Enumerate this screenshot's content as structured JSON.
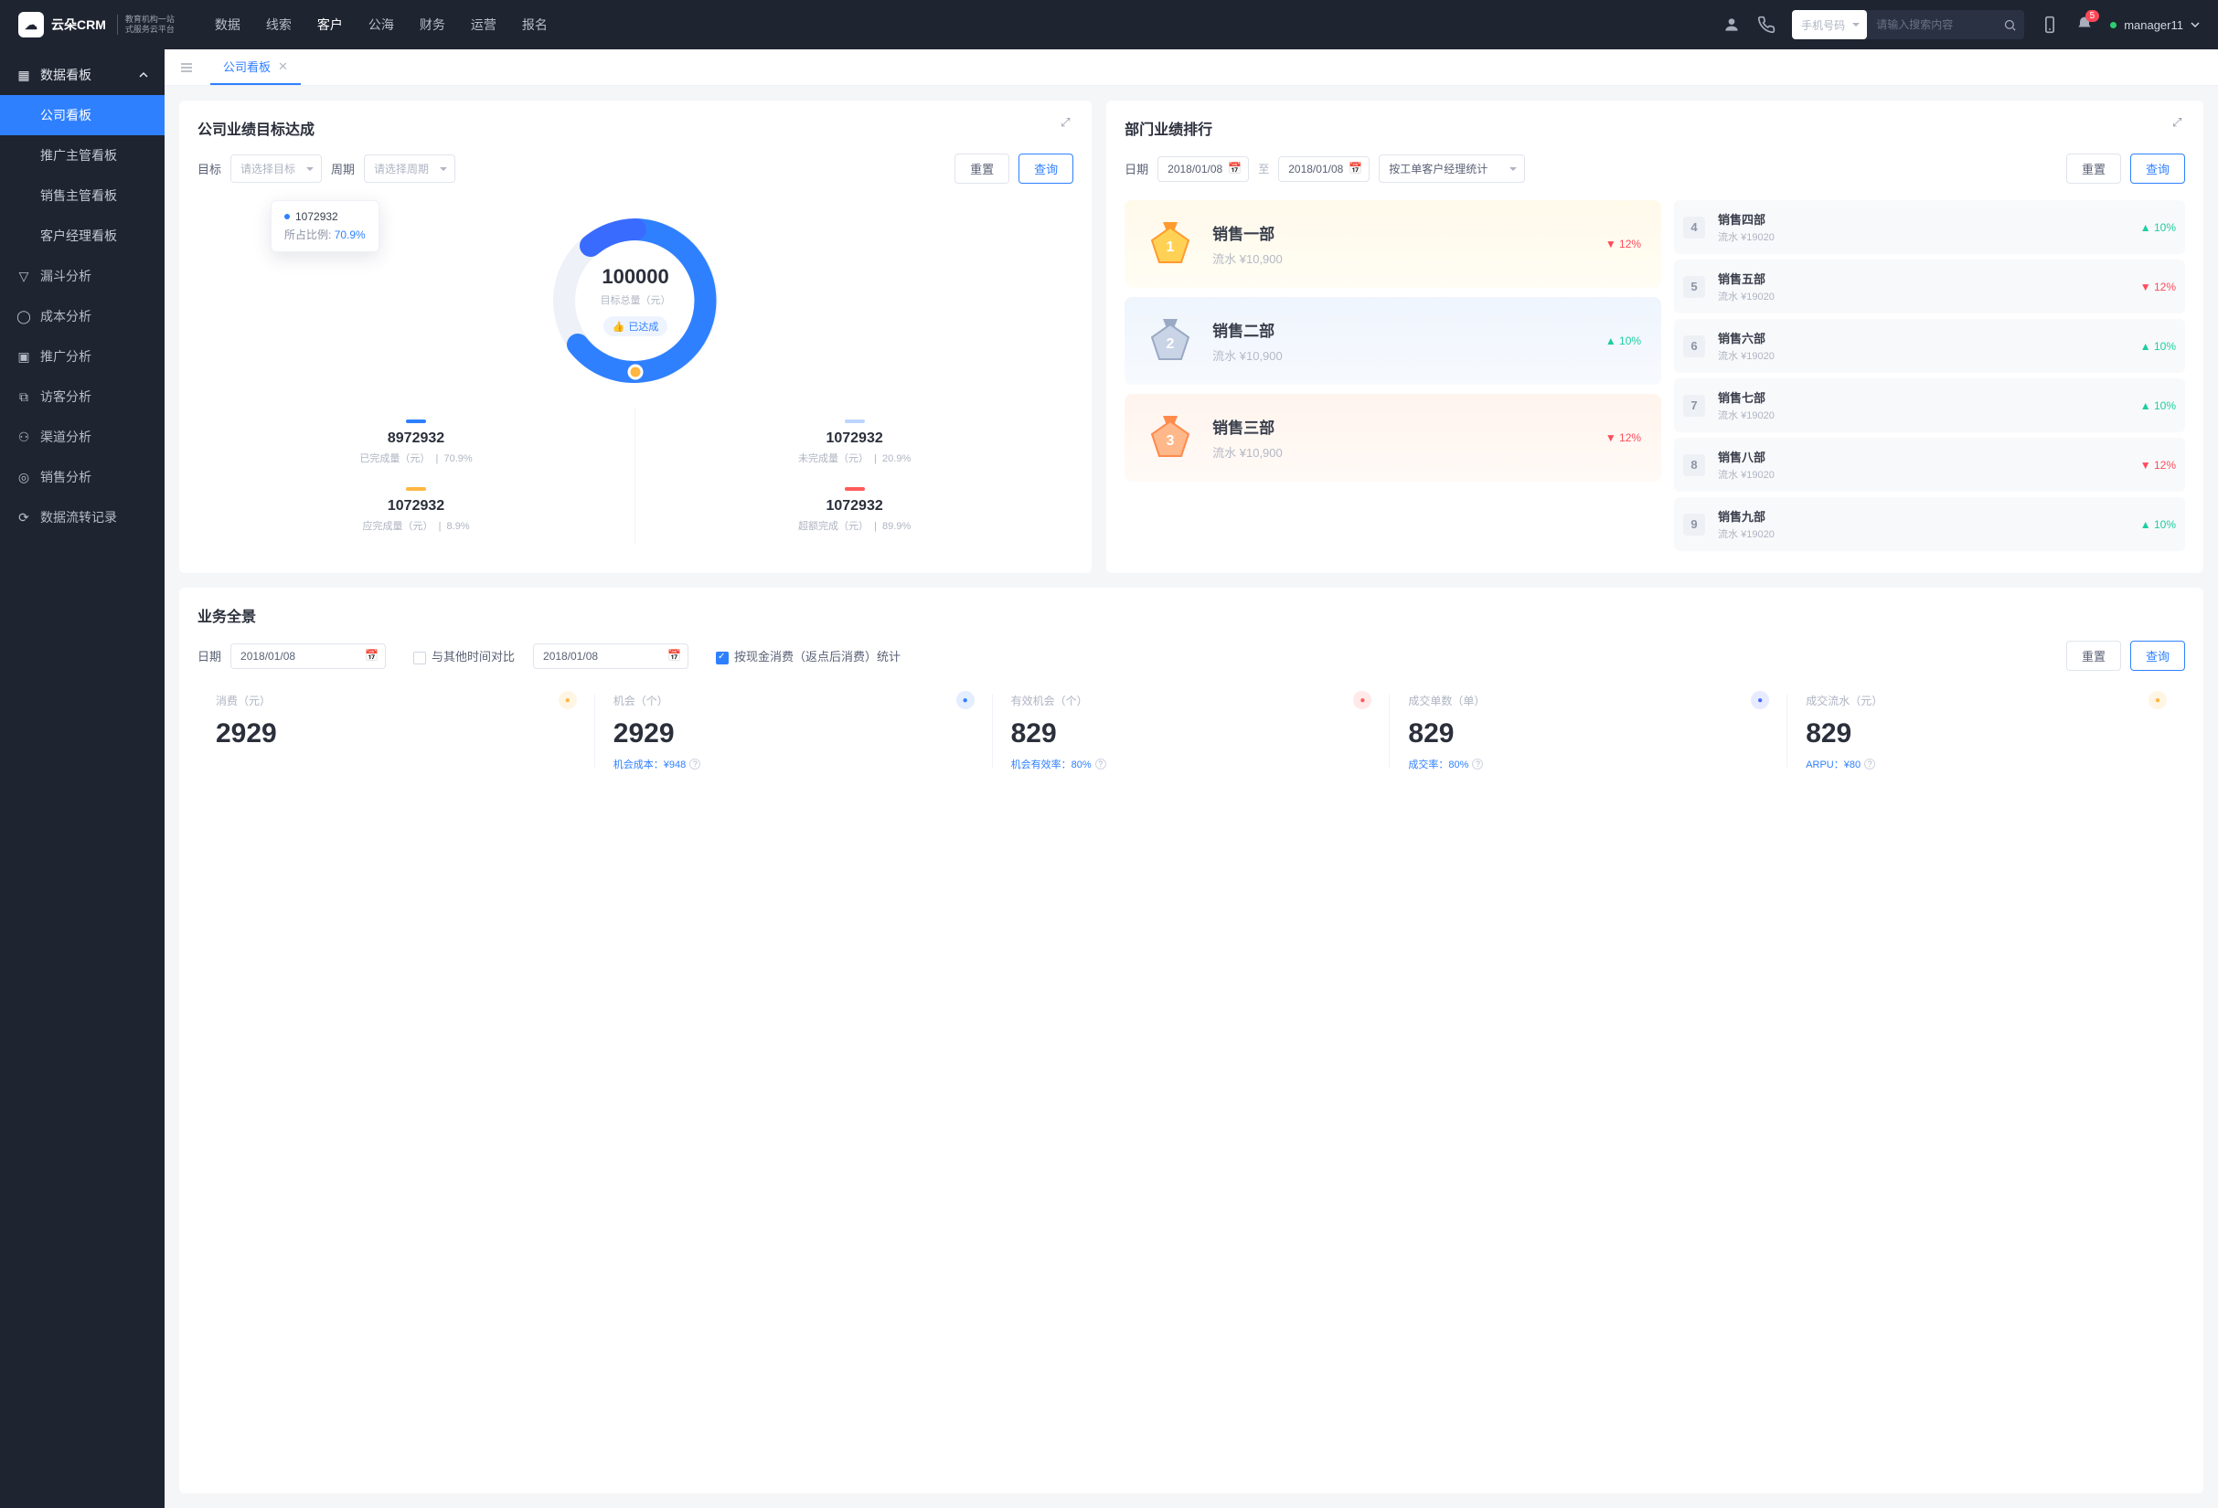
{
  "brand": {
    "name": "云朵CRM",
    "tagline1": "教育机构一站",
    "tagline2": "式服务云平台"
  },
  "topnav": [
    "数据",
    "线索",
    "客户",
    "公海",
    "财务",
    "运营",
    "报名"
  ],
  "topnav_active": 2,
  "search": {
    "type": "手机号码",
    "placeholder": "请输入搜索内容"
  },
  "notif_count": "5",
  "user": "manager11",
  "sidebar": {
    "header": "数据看板",
    "subs": [
      "公司看板",
      "推广主管看板",
      "销售主管看板",
      "客户经理看板"
    ],
    "items": [
      "漏斗分析",
      "成本分析",
      "推广分析",
      "访客分析",
      "渠道分析",
      "销售分析",
      "数据流转记录"
    ]
  },
  "tab": {
    "label": "公司看板"
  },
  "goal": {
    "title": "公司业绩目标达成",
    "labels": {
      "target": "目标",
      "target_ph": "请选择目标",
      "period": "周期",
      "period_ph": "请选择周期",
      "reset": "重置",
      "query": "查询"
    },
    "tooltip": {
      "value": "1072932",
      "ratio_label": "所占比例:",
      "ratio": "70.9%"
    },
    "center": {
      "value": "100000",
      "label": "目标总量（元）",
      "badge": "已达成"
    },
    "stats": [
      {
        "bar": "#2f80ff",
        "value": "8972932",
        "label": "已完成量（元）",
        "pct": "70.9%"
      },
      {
        "bar": "#bcd5ff",
        "value": "1072932",
        "label": "未完成量（元）",
        "pct": "20.9%"
      },
      {
        "bar": "#ffb73f",
        "value": "1072932",
        "label": "应完成量（元）",
        "pct": "8.9%"
      },
      {
        "bar": "#ff5a5a",
        "value": "1072932",
        "label": "超额完成（元）",
        "pct": "89.9%"
      }
    ]
  },
  "rank": {
    "title": "部门业绩排行",
    "labels": {
      "date": "日期",
      "from": "2018/01/08",
      "sep": "至",
      "to": "2018/01/08",
      "stat_by": "按工单客户经理统计",
      "reset": "重置",
      "query": "查询"
    },
    "podium": [
      {
        "n": "1",
        "name": "销售一部",
        "sub": "流水 ¥10,900",
        "delta": "12%",
        "dir": "down"
      },
      {
        "n": "2",
        "name": "销售二部",
        "sub": "流水 ¥10,900",
        "delta": "10%",
        "dir": "up"
      },
      {
        "n": "3",
        "name": "销售三部",
        "sub": "流水 ¥10,900",
        "delta": "12%",
        "dir": "down"
      }
    ],
    "list": [
      {
        "n": "4",
        "name": "销售四部",
        "sub": "流水 ¥19020",
        "delta": "10%",
        "dir": "up"
      },
      {
        "n": "5",
        "name": "销售五部",
        "sub": "流水 ¥19020",
        "delta": "12%",
        "dir": "down"
      },
      {
        "n": "6",
        "name": "销售六部",
        "sub": "流水 ¥19020",
        "delta": "10%",
        "dir": "up"
      },
      {
        "n": "7",
        "name": "销售七部",
        "sub": "流水 ¥19020",
        "delta": "10%",
        "dir": "up"
      },
      {
        "n": "8",
        "name": "销售八部",
        "sub": "流水 ¥19020",
        "delta": "12%",
        "dir": "down"
      },
      {
        "n": "9",
        "name": "销售九部",
        "sub": "流水 ¥19020",
        "delta": "10%",
        "dir": "up"
      }
    ]
  },
  "overview": {
    "title": "业务全景",
    "labels": {
      "date": "日期",
      "d1": "2018/01/08",
      "compare": "与其他时间对比",
      "d2": "2018/01/08",
      "opt": "按现金消费（返点后消费）统计",
      "reset": "重置",
      "query": "查询"
    },
    "items": [
      {
        "label": "消费（元）",
        "value": "2929",
        "sub": "",
        "icon": "money",
        "ic": "#ffb73f"
      },
      {
        "label": "机会（个）",
        "value": "2929",
        "sub": "机会成本：¥948",
        "icon": "send",
        "ic": "#2f80ff"
      },
      {
        "label": "有效机会（个）",
        "value": "829",
        "sub": "机会有效率：80%",
        "icon": "shield",
        "ic": "#ff5a5a"
      },
      {
        "label": "成交单数（单）",
        "value": "829",
        "sub": "成交率：80%",
        "icon": "doc",
        "ic": "#4a6bff"
      },
      {
        "label": "成交流水（元）",
        "value": "829",
        "sub": "ARPU：¥80",
        "icon": "card",
        "ic": "#ffb73f"
      }
    ]
  },
  "chart_data": {
    "type": "pie",
    "title": "公司业绩目标达成",
    "total_label": "目标总量（元）",
    "total": 100000,
    "series": [
      {
        "name": "已完成量（元）",
        "value": 8972932,
        "pct": 70.9,
        "color": "#2f80ff"
      },
      {
        "name": "未完成量（元）",
        "value": 1072932,
        "pct": 20.9,
        "color": "#bcd5ff"
      },
      {
        "name": "应完成量（元）",
        "value": 1072932,
        "pct": 8.9,
        "color": "#ffb73f"
      },
      {
        "name": "超额完成（元）",
        "value": 1072932,
        "pct": 89.9,
        "color": "#ff5a5a"
      }
    ]
  }
}
